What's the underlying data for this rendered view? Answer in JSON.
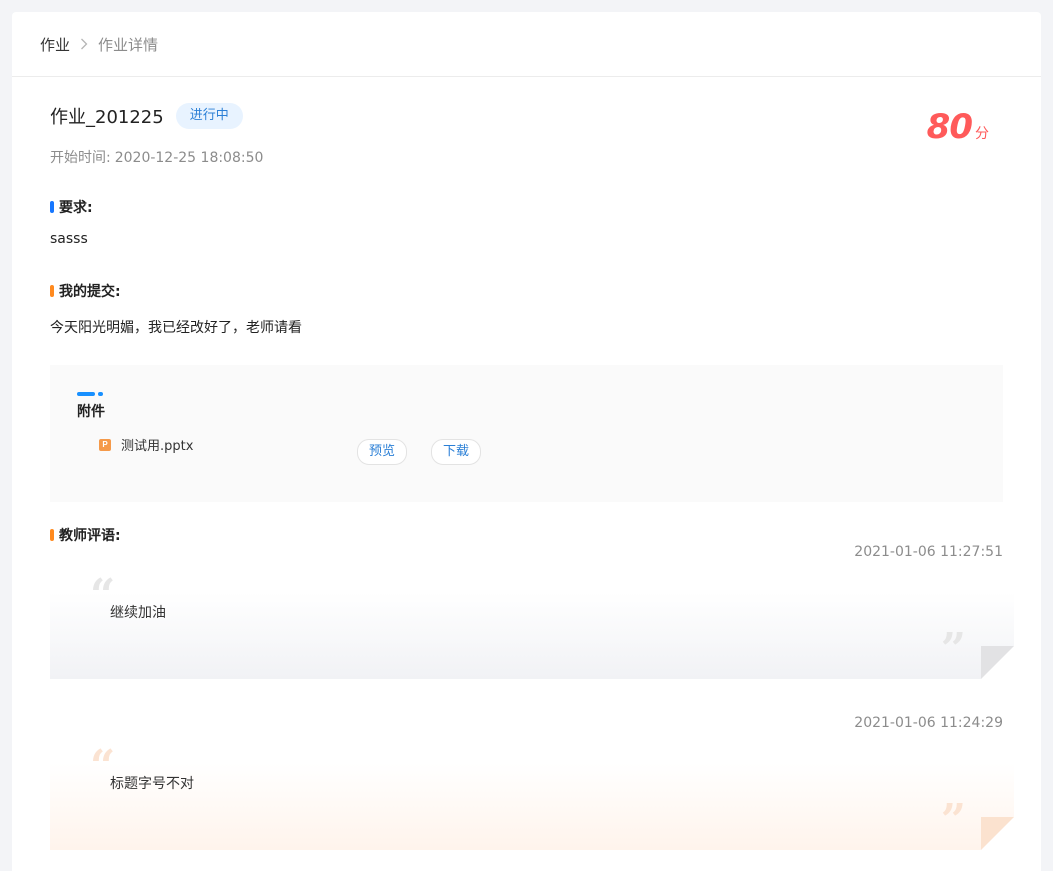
{
  "breadcrumb": {
    "home": "作业",
    "current": "作业详情"
  },
  "assignment": {
    "title": "作业_201225",
    "status": "进行中",
    "start_label": "开始时间:",
    "start_time": "2020-12-25 18:08:50",
    "score": "80",
    "score_unit": "分"
  },
  "requirements": {
    "label": "要求:",
    "text": "sasss"
  },
  "submission": {
    "label": "我的提交:",
    "text": "今天阳光明媚，我已经改好了，老师请看"
  },
  "attachments": {
    "title": "附件",
    "files": [
      {
        "icon": "pptx-file-icon",
        "icon_letter": "P",
        "name": "测试用.pptx"
      }
    ],
    "preview_label": "预览",
    "download_label": "下载"
  },
  "teacher_comments": {
    "label": "教师评语:",
    "items": [
      {
        "time": "2021-01-06 11:27:51",
        "text": "继续加油"
      },
      {
        "time": "2021-01-06 11:24:29",
        "text": "标题字号不对"
      }
    ]
  },
  "colors": {
    "accent": "#1677ff",
    "score": "#ff5a5a",
    "section_bar_orange": "#ff8a1f",
    "status_bg": "#e8f3ff"
  }
}
